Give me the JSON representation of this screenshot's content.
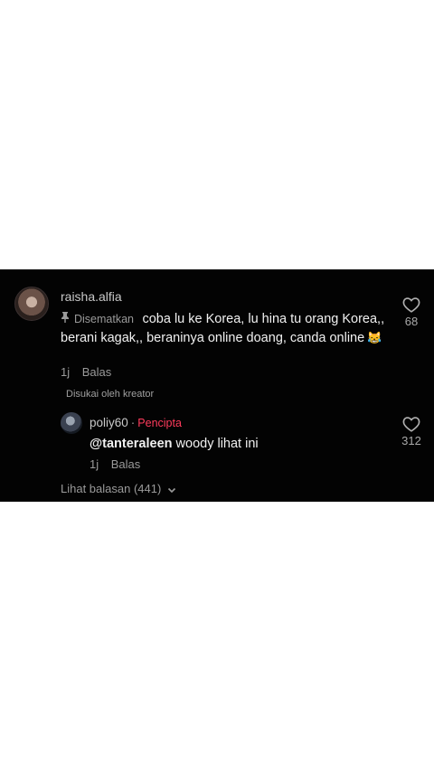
{
  "comment": {
    "username": "raisha.alfia",
    "pinned_label": "Disematkan",
    "text": "coba lu ke Korea, lu hina tu orang Korea,, berani kagak,, beraninya online doang, canda online",
    "emoji": "😹",
    "time": "1j",
    "reply_label": "Balas",
    "liked_by_creator": "Disukai oleh kreator",
    "like_count": "68"
  },
  "reply": {
    "username": "poliy60",
    "separator": "·",
    "creator_badge": "Pencipta",
    "mention": "@tanteraleen",
    "text": " woody lihat ini",
    "time": "1j",
    "reply_label": "Balas",
    "like_count": "312"
  },
  "view_replies": "Lihat balasan (441)",
  "colors": {
    "panel_bg": "#030303",
    "creator_badge": "#ff3b5c"
  }
}
